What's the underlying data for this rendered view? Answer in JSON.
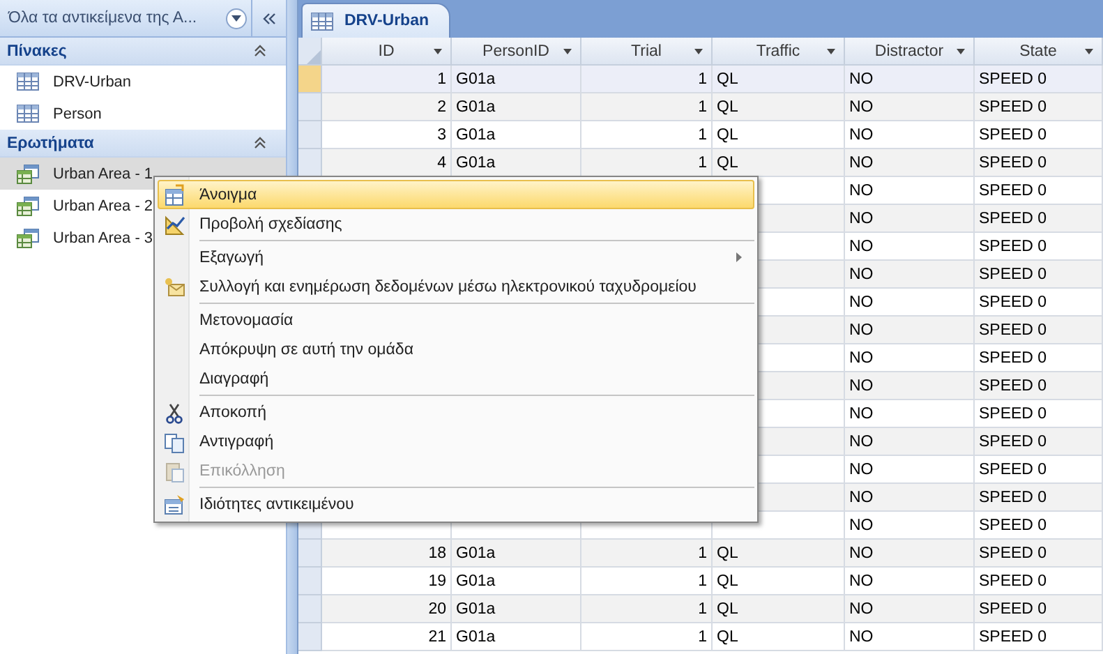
{
  "navigation_pane": {
    "title": "Όλα τα αντικείμενα της Α...",
    "groups": [
      {
        "title": "Πίνακες",
        "expanded": true,
        "items": [
          {
            "label": "DRV-Urban",
            "kind": "table",
            "selected": false
          },
          {
            "label": "Person",
            "kind": "table",
            "selected": false
          }
        ]
      },
      {
        "title": "Ερωτήματα",
        "expanded": true,
        "items": [
          {
            "label": "Urban Area - 1",
            "kind": "query",
            "selected": true
          },
          {
            "label": "Urban Area - 2",
            "kind": "query",
            "selected": false
          },
          {
            "label": "Urban Area - 3",
            "kind": "query",
            "selected": false
          }
        ]
      }
    ]
  },
  "document_tab": {
    "label": "DRV-Urban"
  },
  "table": {
    "columns": [
      "ID",
      "PersonID",
      "Trial",
      "Traffic",
      "Distractor",
      "State"
    ],
    "rows": [
      {
        "cells": [
          "1",
          "G01a",
          "1",
          "QL",
          "NO",
          "SPEED 0"
        ],
        "selected": true
      },
      {
        "cells": [
          "2",
          "G01a",
          "1",
          "QL",
          "NO",
          "SPEED 0"
        ],
        "selected": false
      },
      {
        "cells": [
          "3",
          "G01a",
          "1",
          "QL",
          "NO",
          "SPEED 0"
        ],
        "selected": false
      },
      {
        "cells": [
          "4",
          "G01a",
          "1",
          "QL",
          "NO",
          "SPEED 0"
        ],
        "selected": false
      },
      {
        "cells": [
          null,
          null,
          null,
          null,
          "NO",
          "SPEED 0"
        ]
      },
      {
        "cells": [
          null,
          null,
          null,
          null,
          "NO",
          "SPEED 0"
        ]
      },
      {
        "cells": [
          null,
          null,
          null,
          null,
          "NO",
          "SPEED 0"
        ]
      },
      {
        "cells": [
          null,
          null,
          null,
          null,
          "NO",
          "SPEED 0"
        ]
      },
      {
        "cells": [
          null,
          null,
          null,
          null,
          "NO",
          "SPEED 0"
        ]
      },
      {
        "cells": [
          null,
          null,
          null,
          null,
          "NO",
          "SPEED 0"
        ]
      },
      {
        "cells": [
          null,
          null,
          null,
          null,
          "NO",
          "SPEED 0"
        ]
      },
      {
        "cells": [
          null,
          null,
          null,
          null,
          "NO",
          "SPEED 0"
        ]
      },
      {
        "cells": [
          null,
          null,
          null,
          null,
          "NO",
          "SPEED 0"
        ]
      },
      {
        "cells": [
          null,
          null,
          null,
          null,
          "NO",
          "SPEED 0"
        ]
      },
      {
        "cells": [
          null,
          null,
          null,
          null,
          "NO",
          "SPEED 0"
        ]
      },
      {
        "cells": [
          null,
          null,
          null,
          null,
          "NO",
          "SPEED 0"
        ]
      },
      {
        "cells": [
          null,
          null,
          null,
          null,
          "NO",
          "SPEED 0"
        ],
        "selected": false
      },
      {
        "cells": [
          "18",
          "G01a",
          "1",
          "QL",
          "NO",
          "SPEED 0"
        ],
        "selected": false
      },
      {
        "cells": [
          "19",
          "G01a",
          "1",
          "QL",
          "NO",
          "SPEED 0"
        ],
        "selected": false
      },
      {
        "cells": [
          "20",
          "G01a",
          "1",
          "QL",
          "NO",
          "SPEED 0"
        ],
        "selected": false
      },
      {
        "cells": [
          "21",
          "G01a",
          "1",
          "QL",
          "NO",
          "SPEED 0"
        ],
        "selected": false
      }
    ]
  },
  "context_menu": {
    "groups": [
      [
        {
          "label": "Άνοιγμα",
          "selected": true,
          "disabled": false
        },
        {
          "label": "Προβολή σχεδίασης",
          "selected": false,
          "disabled": false
        }
      ],
      [
        {
          "label": "Εξαγωγή",
          "selected": false,
          "disabled": false,
          "submenu": true
        },
        {
          "label": "Συλλογή και ενημέρωση δεδομένων μέσω ηλεκτρονικού ταχυδρομείου",
          "selected": false,
          "disabled": false
        }
      ],
      [
        {
          "label": "Μετονομασία",
          "selected": false,
          "disabled": false
        },
        {
          "label": "Απόκρυψη σε αυτή την ομάδα",
          "selected": false,
          "disabled": false
        },
        {
          "label": "Διαγραφή",
          "selected": false,
          "disabled": false
        }
      ],
      [
        {
          "label": "Αποκοπή",
          "selected": false,
          "disabled": false
        },
        {
          "label": "Αντιγραφή",
          "selected": false,
          "disabled": false
        },
        {
          "label": "Επικόλληση",
          "selected": false,
          "disabled": true
        }
      ],
      [
        {
          "label": "Ιδιότητες αντικειμένου",
          "selected": false,
          "disabled": false
        }
      ]
    ]
  }
}
